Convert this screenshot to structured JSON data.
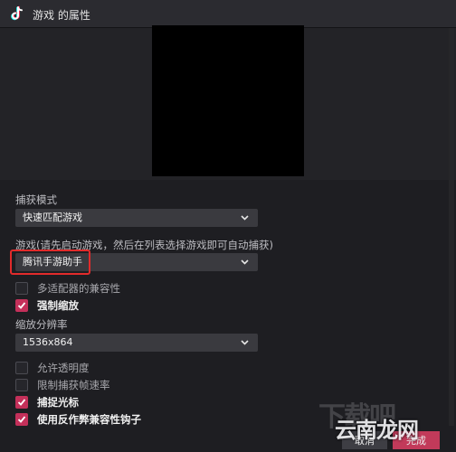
{
  "window": {
    "title": "游戏 的属性",
    "icon": "tiktok-logo-icon"
  },
  "capture_mode": {
    "label": "捕获模式",
    "value": "快速匹配游戏"
  },
  "game": {
    "label": "游戏(请先启动游戏，然后在列表选择游戏即可自动捕获)",
    "value": "腾讯手游助手"
  },
  "checkboxes_top": [
    {
      "label": "多适配器的兼容性",
      "checked": false
    },
    {
      "label": "强制缩放",
      "checked": true
    }
  ],
  "scale": {
    "label": "缩放分辨率",
    "value": "1536x864"
  },
  "checkboxes_bottom": [
    {
      "label": "允许透明度",
      "checked": false
    },
    {
      "label": "限制捕获帧速率",
      "checked": false
    },
    {
      "label": "捕捉光标",
      "checked": true
    },
    {
      "label": "使用反作弊兼容性钩子",
      "checked": true
    }
  ],
  "buttons": {
    "cancel": "取消",
    "done": "完成"
  },
  "watermark": {
    "top": "下载吧",
    "main": "云南龙网"
  },
  "colors": {
    "accent": "#c4305a",
    "highlight": "#e22b2b",
    "background": "#1e1e22"
  }
}
